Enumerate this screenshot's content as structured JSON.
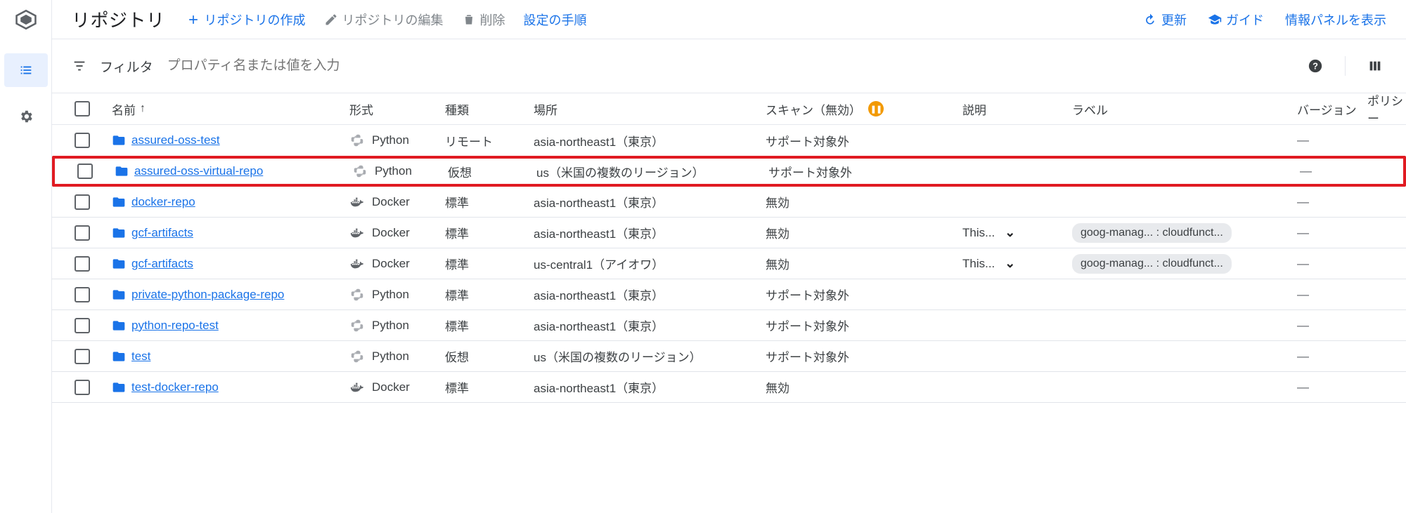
{
  "page": {
    "title": "リポジトリ"
  },
  "toolbar": {
    "create": "リポジトリの作成",
    "edit": "リポジトリの編集",
    "delete": "削除",
    "setup": "設定の手順",
    "refresh": "更新",
    "guide": "ガイド",
    "panel": "情報パネルを表示"
  },
  "filter": {
    "label": "フィルタ",
    "placeholder": "プロパティ名または値を入力"
  },
  "columns": {
    "name": "名前",
    "format": "形式",
    "type": "種類",
    "location": "場所",
    "scan": "スキャン（無効）",
    "description": "説明",
    "labels": "ラベル",
    "version": "バージョン",
    "policy": "ポリシー"
  },
  "rows": [
    {
      "name": "assured-oss-test",
      "format": "Python",
      "formatIcon": "python",
      "type": "リモート",
      "location": "asia-northeast1（東京）",
      "scan": "サポート対象外",
      "desc": "",
      "expand": false,
      "label": "",
      "version": "—"
    },
    {
      "name": "assured-oss-virtual-repo",
      "format": "Python",
      "formatIcon": "python",
      "type": "仮想",
      "location": "us（米国の複数のリージョン）",
      "scan": "サポート対象外",
      "desc": "",
      "expand": false,
      "label": "",
      "version": "—",
      "highlight": true
    },
    {
      "name": "docker-repo",
      "format": "Docker",
      "formatIcon": "docker",
      "type": "標準",
      "location": "asia-northeast1（東京）",
      "scan": "無効",
      "desc": "",
      "expand": false,
      "label": "",
      "version": "—"
    },
    {
      "name": "gcf-artifacts",
      "format": "Docker",
      "formatIcon": "docker",
      "type": "標準",
      "location": "asia-northeast1（東京）",
      "scan": "無効",
      "desc": "This...",
      "expand": true,
      "label": "goog-manag... : cloudfunct...",
      "version": "—"
    },
    {
      "name": "gcf-artifacts",
      "format": "Docker",
      "formatIcon": "docker",
      "type": "標準",
      "location": "us-central1（アイオワ）",
      "scan": "無効",
      "desc": "This...",
      "expand": true,
      "label": "goog-manag... : cloudfunct...",
      "version": "—"
    },
    {
      "name": "private-python-package-repo",
      "format": "Python",
      "formatIcon": "python",
      "type": "標準",
      "location": "asia-northeast1（東京）",
      "scan": "サポート対象外",
      "desc": "",
      "expand": false,
      "label": "",
      "version": "—"
    },
    {
      "name": "python-repo-test",
      "format": "Python",
      "formatIcon": "python",
      "type": "標準",
      "location": "asia-northeast1（東京）",
      "scan": "サポート対象外",
      "desc": "",
      "expand": false,
      "label": "",
      "version": "—"
    },
    {
      "name": "test",
      "format": "Python",
      "formatIcon": "python",
      "type": "仮想",
      "location": "us（米国の複数のリージョン）",
      "scan": "サポート対象外",
      "desc": "",
      "expand": false,
      "label": "",
      "version": "—"
    },
    {
      "name": "test-docker-repo",
      "format": "Docker",
      "formatIcon": "docker",
      "type": "標準",
      "location": "asia-northeast1（東京）",
      "scan": "無効",
      "desc": "",
      "expand": false,
      "label": "",
      "version": "—"
    }
  ]
}
